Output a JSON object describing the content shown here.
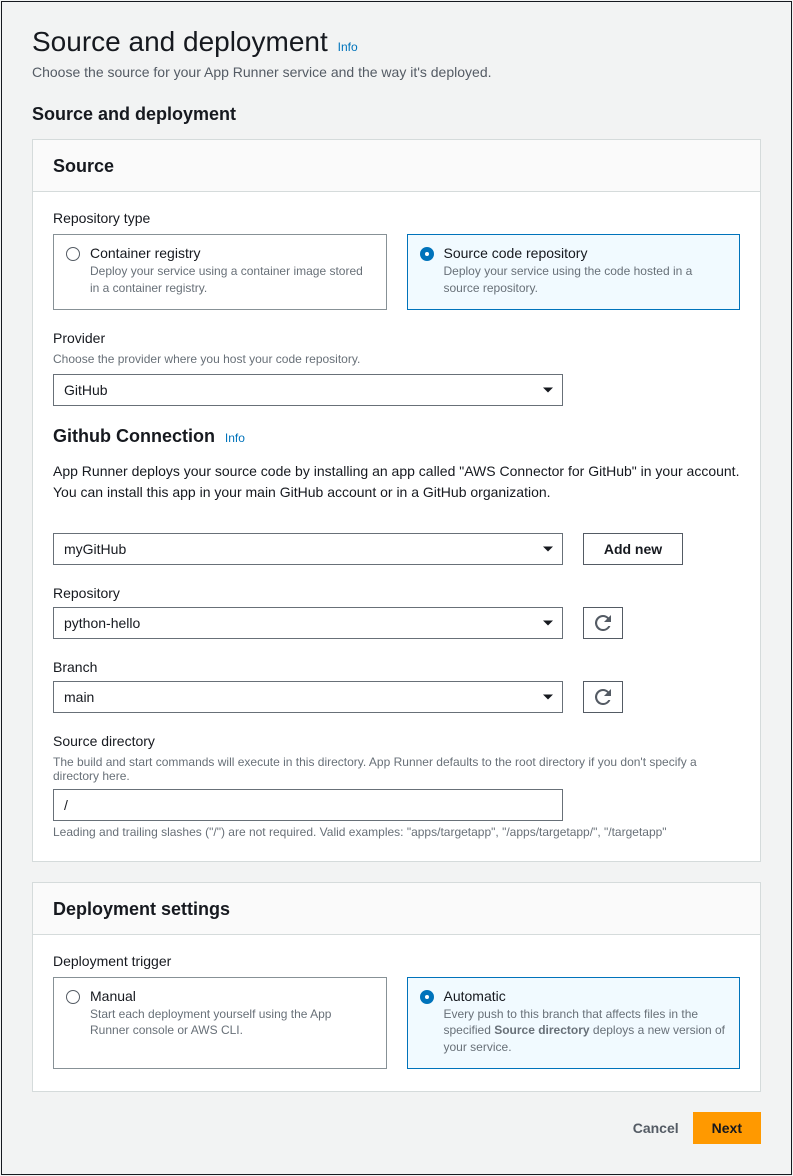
{
  "page": {
    "title": "Source and deployment",
    "info": "Info",
    "subtitle": "Choose the source for your App Runner service and the way it's deployed.",
    "section_heading": "Source and deployment"
  },
  "source": {
    "card_title": "Source",
    "repo_type_label": "Repository type",
    "repo_options": {
      "container": {
        "title": "Container registry",
        "desc": "Deploy your service using a container image stored in a container registry."
      },
      "source_code": {
        "title": "Source code repository",
        "desc": "Deploy your service using the code hosted in a source repository."
      }
    },
    "provider": {
      "label": "Provider",
      "hint": "Choose the provider where you host your code repository.",
      "value": "GitHub"
    },
    "connection": {
      "heading": "Github Connection",
      "info": "Info",
      "desc": "App Runner deploys your source code by installing an app called \"AWS Connector for GitHub\" in your account. You can install this app in your main GitHub account or in a GitHub organization.",
      "value": "myGitHub",
      "add_new": "Add new"
    },
    "repository": {
      "label": "Repository",
      "value": "python-hello"
    },
    "branch": {
      "label": "Branch",
      "value": "main"
    },
    "source_dir": {
      "label": "Source directory",
      "hint_top": "The build and start commands will execute in this directory. App Runner defaults to the root directory if you don't specify a directory here.",
      "value": "/",
      "hint_bottom": "Leading and trailing slashes (\"/\") are not required. Valid examples: \"apps/targetapp\", \"/apps/targetapp/\", \"/targetapp\""
    }
  },
  "deployment": {
    "card_title": "Deployment settings",
    "trigger_label": "Deployment trigger",
    "options": {
      "manual": {
        "title": "Manual",
        "desc": "Start each deployment yourself using the App Runner console or AWS CLI."
      },
      "automatic": {
        "title": "Automatic",
        "desc_pre": "Every push to this branch that affects files in the specified ",
        "desc_bold": "Source directory",
        "desc_post": " deploys a new version of your service."
      }
    }
  },
  "footer": {
    "cancel": "Cancel",
    "next": "Next"
  }
}
